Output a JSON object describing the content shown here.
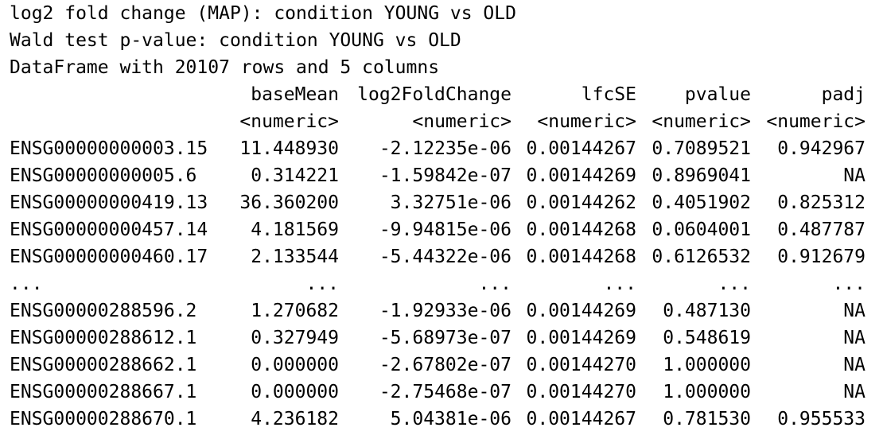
{
  "header_lines": [
    "log2 fold change (MAP): condition YOUNG vs OLD",
    "Wald test p-value: condition YOUNG vs OLD",
    "DataFrame with 20107 rows and 5 columns"
  ],
  "table": {
    "columns": [
      "",
      "baseMean",
      "log2FoldChange",
      "lfcSE",
      "pvalue",
      "padj"
    ],
    "types": [
      "",
      "<numeric>",
      "<numeric>",
      "<numeric>",
      "<numeric>",
      "<numeric>"
    ],
    "rows": [
      [
        "ENSG00000000003.15",
        "11.448930",
        "-2.12235e-06",
        "0.00144267",
        "0.7089521",
        "0.942967"
      ],
      [
        "ENSG00000000005.6",
        "0.314221",
        "-1.59842e-07",
        "0.00144269",
        "0.8969041",
        "NA"
      ],
      [
        "ENSG00000000419.13",
        "36.360200",
        "3.32751e-06",
        "0.00144262",
        "0.4051902",
        "0.825312"
      ],
      [
        "ENSG00000000457.14",
        "4.181569",
        "-9.94815e-06",
        "0.00144268",
        "0.0604001",
        "0.487787"
      ],
      [
        "ENSG00000000460.17",
        "2.133544",
        "-5.44322e-06",
        "0.00144268",
        "0.6126532",
        "0.912679"
      ],
      [
        "...",
        "...",
        "...",
        "...",
        "...",
        "..."
      ],
      [
        "ENSG00000288596.2",
        "1.270682",
        "-1.92933e-06",
        "0.00144269",
        "0.487130",
        "NA"
      ],
      [
        "ENSG00000288612.1",
        "0.327949",
        "-5.68973e-07",
        "0.00144269",
        "0.548619",
        "NA"
      ],
      [
        "ENSG00000288662.1",
        "0.000000",
        "-2.67802e-07",
        "0.00144270",
        "1.000000",
        "NA"
      ],
      [
        "ENSG00000288667.1",
        "0.000000",
        "-2.75468e-07",
        "0.00144270",
        "1.000000",
        "NA"
      ],
      [
        "ENSG00000288670.1",
        "4.236182",
        "5.04381e-06",
        "0.00144267",
        "0.781530",
        "0.955533"
      ]
    ]
  }
}
